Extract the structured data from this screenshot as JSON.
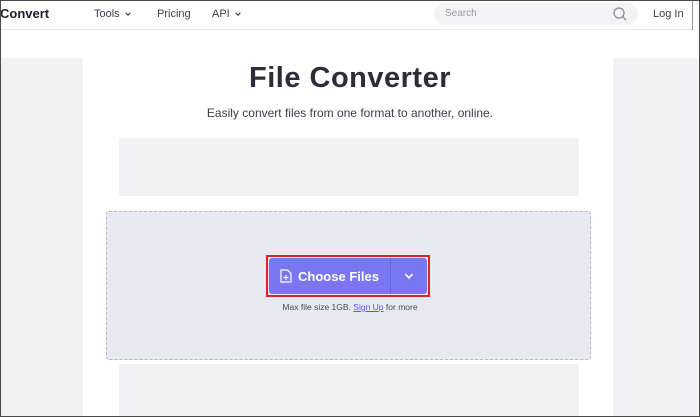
{
  "header": {
    "logo": "Convert",
    "nav": {
      "tools": "Tools",
      "pricing": "Pricing",
      "api": "API"
    },
    "search_placeholder": "Search",
    "login": "Log In"
  },
  "main": {
    "title": "File Converter",
    "subtitle": "Easily convert files from one format to another, online.",
    "choose_button": "Choose Files",
    "max_prefix": "Max file size 1GB.",
    "signup_link": "Sign Up",
    "max_suffix": "for more"
  },
  "colors": {
    "accent": "#7a76f2",
    "highlight": "#d6242a",
    "dropzone": "#e9e9f1"
  },
  "icons": [
    "chevron-down-icon",
    "search-icon",
    "file-plus-icon"
  ]
}
